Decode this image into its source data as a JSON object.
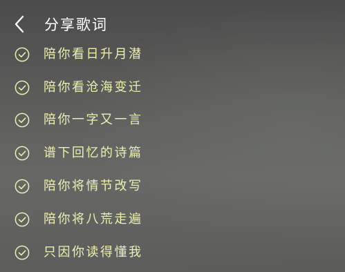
{
  "header": {
    "back_icon": "chevron-left-icon",
    "title": "分享歌词"
  },
  "colors": {
    "lyric_text": "#eef0b0",
    "check_icon": "#eef0b0",
    "title_text": "#ffffff"
  },
  "lyrics": [
    {
      "text": "陪你看日升月潜",
      "selected": true,
      "icon": "check-circle-icon"
    },
    {
      "text": "陪你看沧海变迁",
      "selected": true,
      "icon": "check-circle-icon"
    },
    {
      "text": "陪你一字又一言",
      "selected": true,
      "icon": "check-circle-icon"
    },
    {
      "text": "谱下回忆的诗篇",
      "selected": true,
      "icon": "check-circle-icon"
    },
    {
      "text": "陪你将情节改写",
      "selected": true,
      "icon": "check-circle-icon"
    },
    {
      "text": "陪你将八荒走遍",
      "selected": true,
      "icon": "check-circle-icon"
    },
    {
      "text": "只因你读得懂我",
      "selected": true,
      "icon": "check-circle-icon"
    }
  ]
}
